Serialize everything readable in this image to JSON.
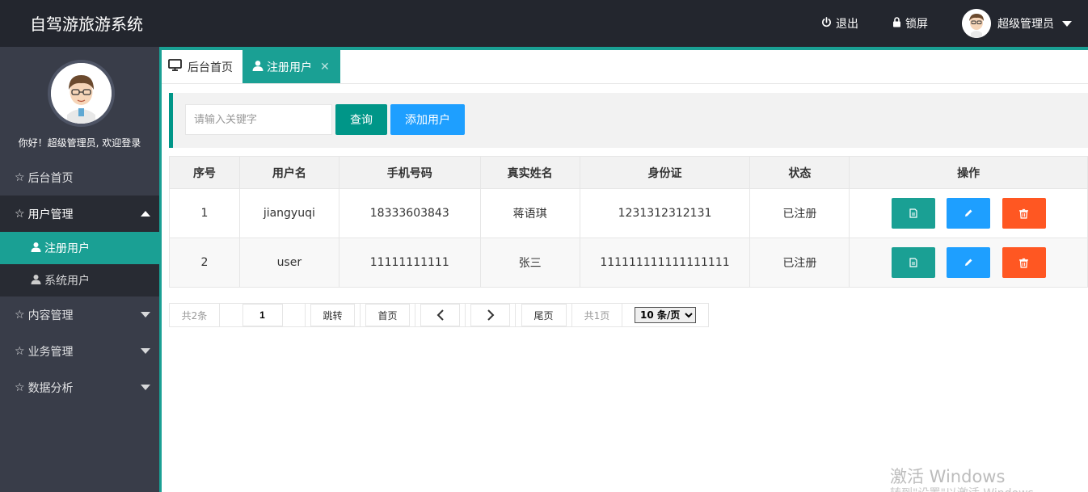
{
  "app": {
    "title": "自驾游旅游系统",
    "logout_label": "退出",
    "lock_label": "锁屏",
    "user_name": "超级管理员"
  },
  "sidebar": {
    "greeting": "你好！超级管理员, 欢迎登录",
    "items": [
      {
        "label": "后台首页"
      },
      {
        "label": "用户管理"
      },
      {
        "label": "内容管理"
      },
      {
        "label": "业务管理"
      },
      {
        "label": "数据分析"
      }
    ],
    "subitems": [
      {
        "label": "注册用户"
      },
      {
        "label": "系统用户"
      }
    ]
  },
  "tabs": [
    {
      "label": "后台首页"
    },
    {
      "label": "注册用户"
    }
  ],
  "search": {
    "placeholder": "请输入关键字",
    "query_label": "查询",
    "add_label": "添加用户"
  },
  "table": {
    "headers": [
      "序号",
      "用户名",
      "手机号码",
      "真实姓名",
      "身份证",
      "状态",
      "操作"
    ],
    "rows": [
      {
        "index": "1",
        "username": "jiangyuqi",
        "phone": "18333603843",
        "realname": "蒋语琪",
        "idcard": "1231312312131",
        "status": "已注册"
      },
      {
        "index": "2",
        "username": "user",
        "phone": "11111111111",
        "realname": "张三",
        "idcard": "111111111111111111",
        "status": "已注册"
      }
    ]
  },
  "pager": {
    "total": "共2条",
    "page_value": "1",
    "jump": "跳转",
    "first": "首页",
    "last": "尾页",
    "pages": "共1页",
    "page_size": "10 条/页"
  },
  "watermark": {
    "line1": "激活 Windows",
    "line2": "转到\"设置\"以激活 Windows。"
  },
  "colors": {
    "header_bg": "#23262e",
    "sidebar_bg": "#393d49",
    "accent": "#1aa094",
    "blue": "#1e9fff",
    "danger": "#ff5722"
  }
}
